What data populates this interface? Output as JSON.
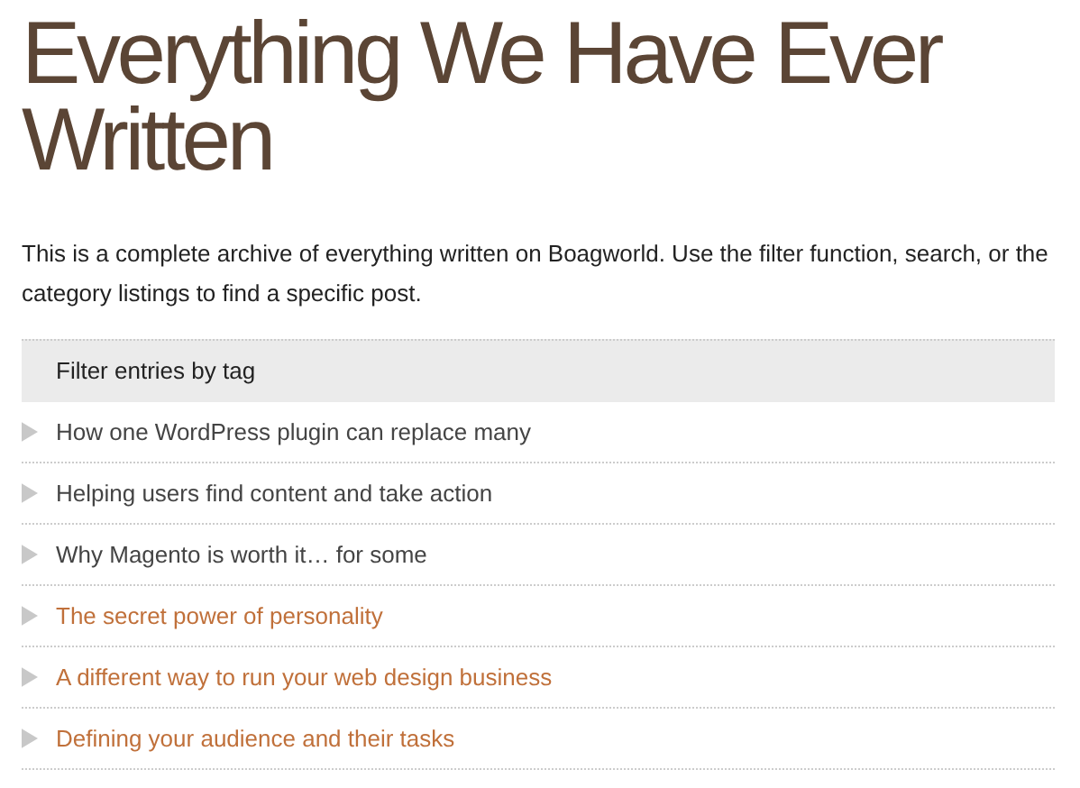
{
  "page_title": "Everything We Have Ever Written",
  "intro": "This is a complete archive of everything written on Boagworld. Use the filter function, search, or the category listings to find a specific post.",
  "filter": {
    "label": "Filter entries by tag"
  },
  "posts": [
    {
      "title": "How one WordPress plugin can replace many",
      "visited": false
    },
    {
      "title": "Helping users find content and take action",
      "visited": false
    },
    {
      "title": "Why Magento is worth it… for some",
      "visited": false
    },
    {
      "title": "The secret power of personality",
      "visited": true
    },
    {
      "title": "A different way to run your web design business",
      "visited": true
    },
    {
      "title": "Defining your audience and their tasks",
      "visited": true
    }
  ]
}
